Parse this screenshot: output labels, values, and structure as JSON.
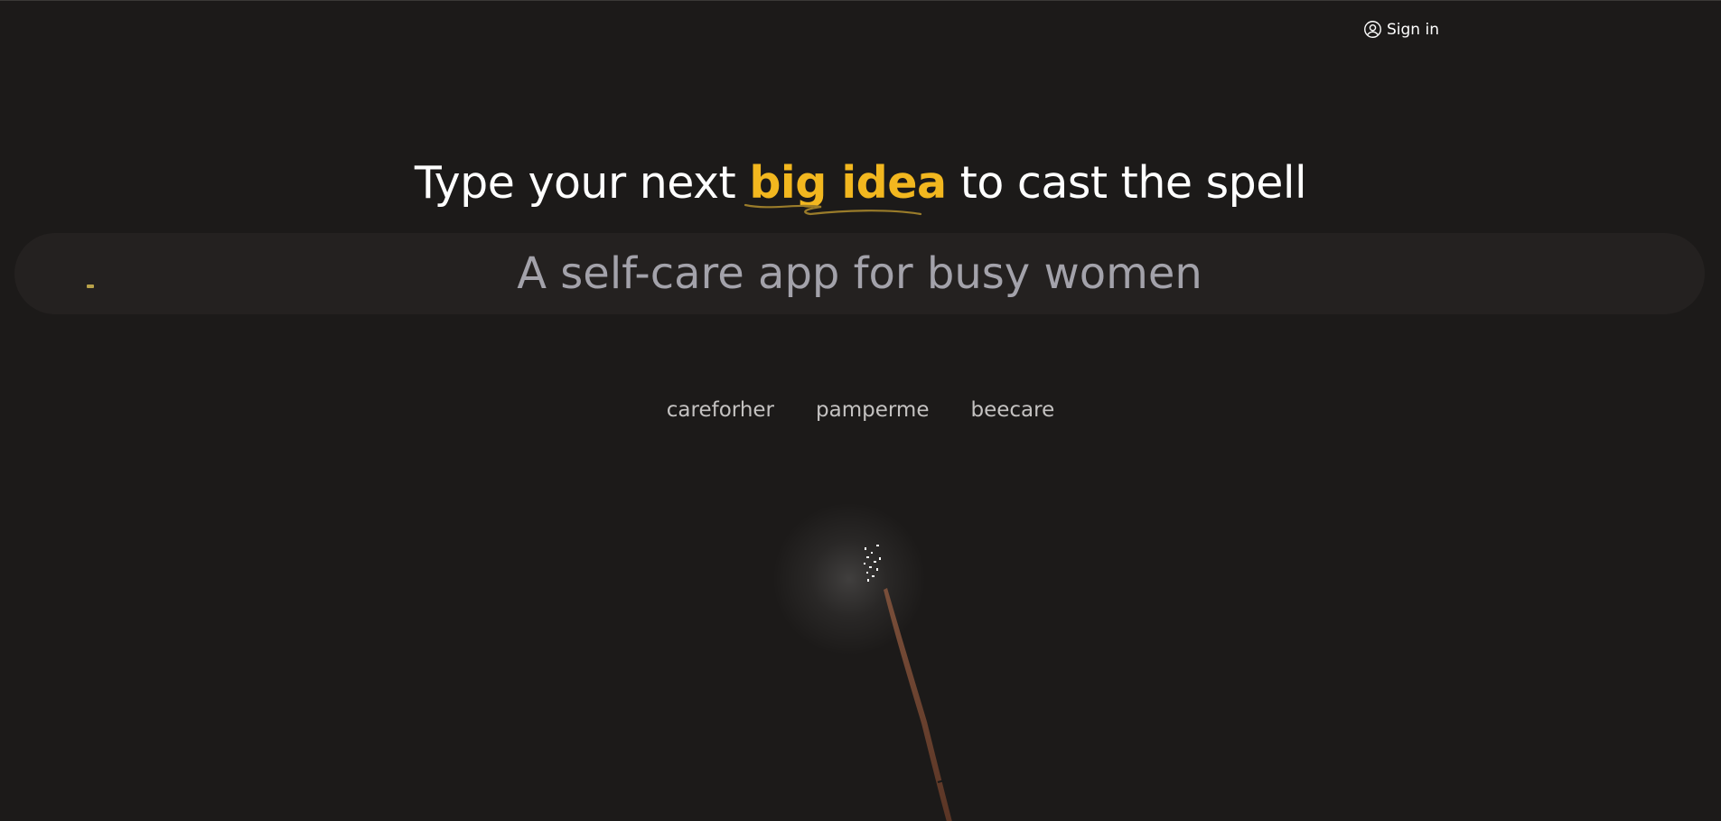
{
  "header": {
    "signin_label": "Sign in",
    "signin_icon": "user-circle-icon"
  },
  "hero": {
    "headline_before": "Type your next",
    "headline_accent": "big idea",
    "headline_after": "to cast the spell",
    "accent_color": "#f2b71f"
  },
  "idea_input": {
    "placeholder": "A self-care app for busy women",
    "value": ""
  },
  "suggestions": [
    {
      "label": "careforher"
    },
    {
      "label": "pamperme"
    },
    {
      "label": "beecare"
    }
  ],
  "wand": {
    "icon": "magic-wand-icon",
    "sparkle_icon": "sparkles-icon"
  },
  "colors": {
    "background": "#1c1a19",
    "input_background": "#242120",
    "accent": "#f2b71f"
  }
}
